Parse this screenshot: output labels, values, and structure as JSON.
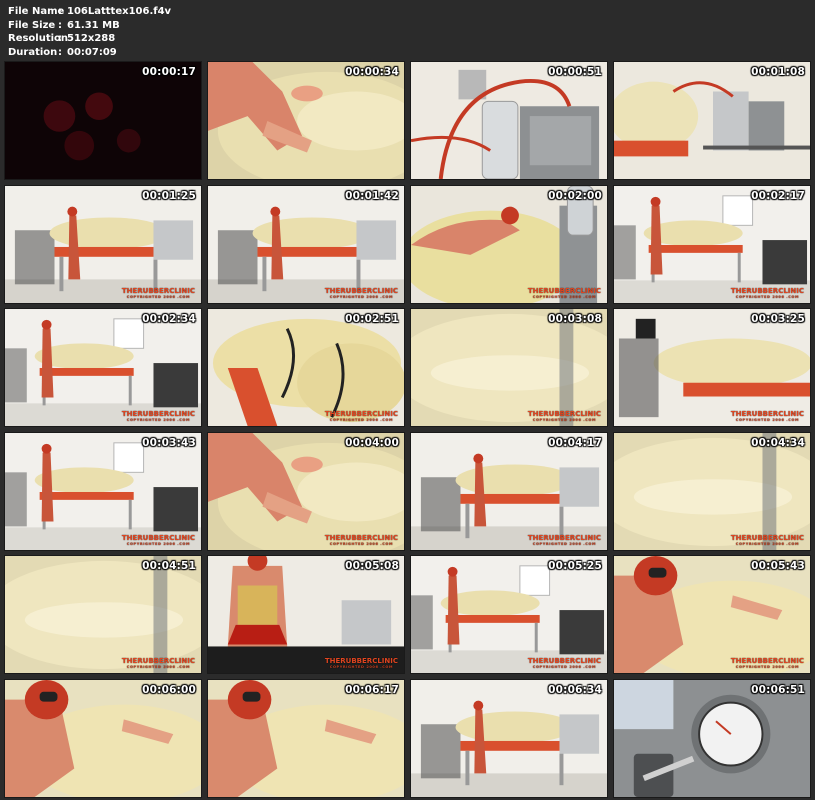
{
  "file_info": [
    {
      "label": "File Name",
      "sep": ":",
      "value": "106Latttex106.f4v"
    },
    {
      "label": "File Size",
      "sep": ":",
      "value": "61.31 MB"
    },
    {
      "label": "Resolution",
      "sep": ":",
      "value": "512x288"
    },
    {
      "label": "Duration",
      "sep": ":",
      "value": "00:07:09"
    }
  ],
  "watermark": {
    "brand": "THERUBBERCLINIC",
    "sub": "COPYRIGHTED 2006 .COM"
  },
  "thumbnails": [
    {
      "time": "00:00:17",
      "scene": "dark",
      "watermark": false
    },
    {
      "time": "00:00:34",
      "scene": "closeup",
      "watermark": false
    },
    {
      "time": "00:00:51",
      "scene": "machine",
      "watermark": false
    },
    {
      "time": "00:01:08",
      "scene": "machine2",
      "watermark": false
    },
    {
      "time": "00:01:25",
      "scene": "room",
      "watermark": true
    },
    {
      "time": "00:01:42",
      "scene": "room",
      "watermark": true
    },
    {
      "time": "00:02:00",
      "scene": "machine-closeup",
      "watermark": true
    },
    {
      "time": "00:02:17",
      "scene": "room-wide",
      "watermark": true
    },
    {
      "time": "00:02:34",
      "scene": "room-wide",
      "watermark": true
    },
    {
      "time": "00:02:51",
      "scene": "bag",
      "watermark": true
    },
    {
      "time": "00:03:08",
      "scene": "bag-closeup",
      "watermark": true
    },
    {
      "time": "00:03:25",
      "scene": "bag-side",
      "watermark": true
    },
    {
      "time": "00:03:43",
      "scene": "room-wide",
      "watermark": true
    },
    {
      "time": "00:04:00",
      "scene": "closeup",
      "watermark": true
    },
    {
      "time": "00:04:17",
      "scene": "room",
      "watermark": true
    },
    {
      "time": "00:04:34",
      "scene": "bag-closeup",
      "watermark": true
    },
    {
      "time": "00:04:51",
      "scene": "bag-closeup",
      "watermark": true
    },
    {
      "time": "00:05:08",
      "scene": "figure",
      "watermark": true
    },
    {
      "time": "00:05:25",
      "scene": "room-wide",
      "watermark": true
    },
    {
      "time": "00:05:43",
      "scene": "figure-bag",
      "watermark": true
    },
    {
      "time": "00:06:00",
      "scene": "figure-bag",
      "watermark": false
    },
    {
      "time": "00:06:17",
      "scene": "figure-bag",
      "watermark": false
    },
    {
      "time": "00:06:34",
      "scene": "room",
      "watermark": false
    },
    {
      "time": "00:06:51",
      "scene": "gauge",
      "watermark": false
    }
  ]
}
